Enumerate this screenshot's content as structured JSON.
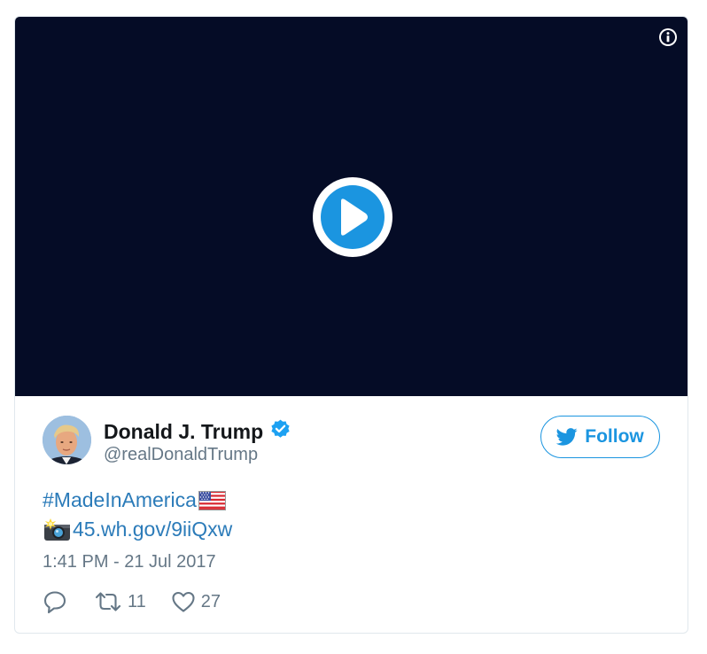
{
  "author": {
    "name": "Donald J. Trump",
    "handle": "@realDonaldTrump"
  },
  "follow": {
    "label": "Follow"
  },
  "tweet": {
    "hashtag": "#MadeInAmerica",
    "link": "45.wh.gov/9iiQxw"
  },
  "timestamp": "1:41 PM - 21 Jul 2017",
  "actions": {
    "retweets": "11",
    "likes": "27"
  },
  "colors": {
    "video_bg": "#050c26",
    "play_button": "#1b95e0",
    "link": "#2b7bb9",
    "verified": "#1da1f2",
    "muted": "#657786"
  },
  "icons": [
    "info-icon",
    "play-icon",
    "verified-icon",
    "twitter-bird-icon",
    "us-flag-icon",
    "camera-flash-icon",
    "reply-icon",
    "retweet-icon",
    "heart-icon"
  ]
}
